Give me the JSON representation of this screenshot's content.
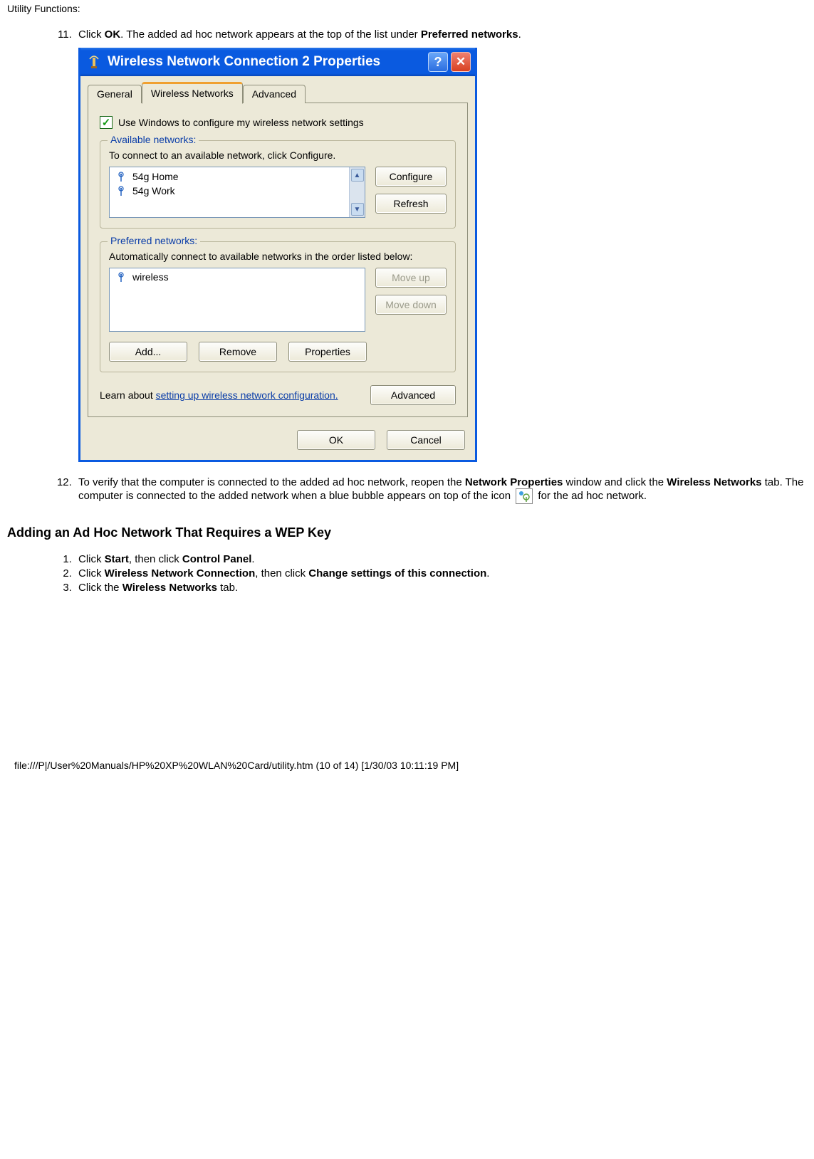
{
  "page": {
    "header": "Utility Functions:",
    "footer": "file:///P|/User%20Manuals/HP%20XP%20WLAN%20Card/utility.htm (10 of 14) [1/30/03 10:11:19 PM]"
  },
  "step11": {
    "pre": "Click ",
    "bold1": "OK",
    "mid": ". The added ad hoc network appears at the top of the list under ",
    "bold2": "Preferred networks",
    "post": "."
  },
  "dialog": {
    "title": "Wireless Network Connection 2 Properties",
    "tabs": {
      "general": "General",
      "wireless": "Wireless Networks",
      "advanced": "Advanced"
    },
    "useWindows": "Use Windows to configure my wireless network settings",
    "available": {
      "title": "Available networks:",
      "desc": "To connect to an available network, click Configure.",
      "items": [
        "54g Home",
        "54g Work"
      ],
      "configure": "Configure",
      "refresh": "Refresh"
    },
    "preferred": {
      "title": "Preferred networks:",
      "desc": "Automatically connect to available networks in the order listed below:",
      "items": [
        "wireless"
      ],
      "moveup": "Move up",
      "movedown": "Move down",
      "add": "Add...",
      "remove": "Remove",
      "properties": "Properties"
    },
    "learn": {
      "pre": "Learn about ",
      "link": "setting up wireless network configuration.",
      "advanced": "Advanced"
    },
    "ok": "OK",
    "cancel": "Cancel"
  },
  "step12": {
    "pre": "To verify that the computer is connected to the added ad hoc network, reopen the ",
    "bold1": "Network Properties",
    "mid1": " window and click the ",
    "bold2": "Wireless Networks",
    "mid2": " tab. The computer is connected to the added network when a blue bubble appears on top of the icon ",
    "post": " for the ad hoc network."
  },
  "subheading": "Adding an Ad Hoc Network That Requires a WEP Key",
  "s1": {
    "pre": "Click ",
    "b1": "Start",
    "mid": ", then click ",
    "b2": "Control Panel",
    "post": "."
  },
  "s2": {
    "pre": "Click ",
    "b1": "Wireless Network Connection",
    "mid": ", then click ",
    "b2": "Change settings of this connection",
    "post": "."
  },
  "s3": {
    "pre": "Click the ",
    "b1": "Wireless Networks",
    "post": " tab."
  }
}
